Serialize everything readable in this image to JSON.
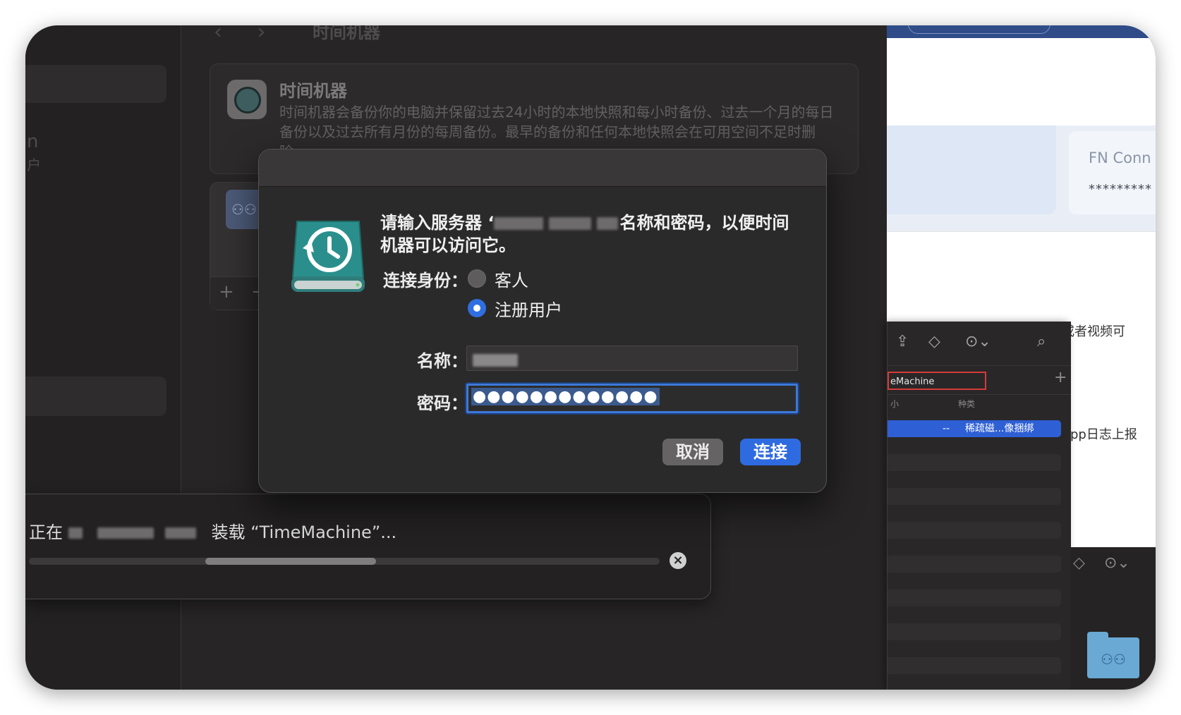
{
  "settings_bg": {
    "sidebar_text_1": "n",
    "sidebar_text_2": "户",
    "nav_title": "时间机器",
    "card_title": "时间机器",
    "card_desc": "时间机器会备份你的电脑并保留过去24小时的本地快照和每小时备份、过去一个月的每日备份以及过去所有月份的每周备份。最早的备份和任何本地快照会在可用空间不足时删除。",
    "add_label": "+",
    "remove_label": "−"
  },
  "dialog": {
    "prompt_before": "请输入服务器 ‘",
    "prompt_after": "名称和密码，以便时间机器可以访问它。",
    "connect_as_label": "连接身份：",
    "options": [
      {
        "label": "客人",
        "selected": false
      },
      {
        "label": "注册用户",
        "selected": true
      }
    ],
    "name_label": "名称：",
    "password_label": "密码：",
    "password_value": "●●●●●●●●●●●●●",
    "cancel_label": "取消",
    "connect_label": "连接"
  },
  "progress": {
    "text_before": "正在",
    "text_after": "装载 “TimeMachine”...",
    "fill_start": 0.28,
    "fill_end": 0.55,
    "close_label": "×"
  },
  "right_window": {
    "fn_title": "FN Conn",
    "fn_value": "*********",
    "text_line_1": "出现了xxx情况，若有现场截图或者视频可",
    "text_line_2": "pp日志上报"
  },
  "finder": {
    "path_text": "eMachine",
    "col_size": "小",
    "col_kind": "种类",
    "row_dash": "--",
    "row_kind": "稀疏磁...像捆绑",
    "plus_label": "+"
  },
  "colors": {
    "accent": "#2f6be0",
    "dialog_bg": "#2b2a2a",
    "highlight_red": "#d63b3b"
  }
}
